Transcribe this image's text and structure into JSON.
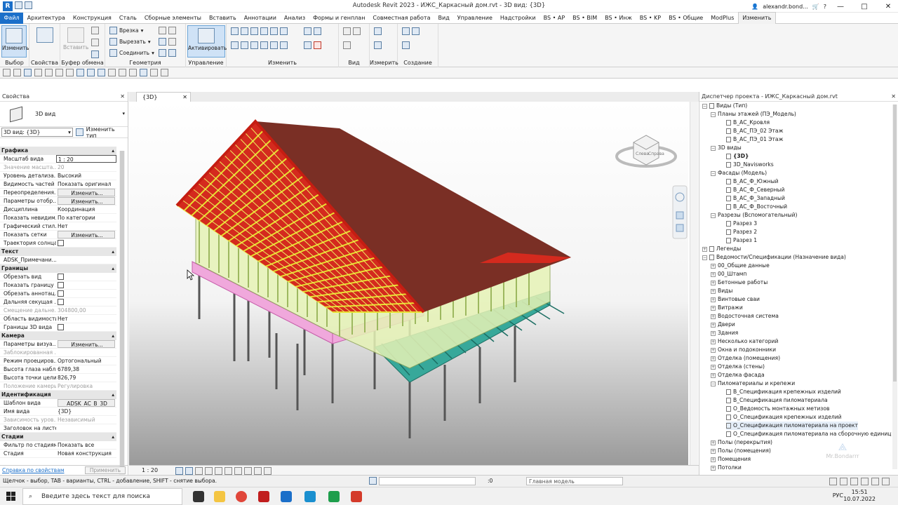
{
  "window": {
    "title": "Autodesk Revit 2023 - ИЖС_Каркасный дом.rvt - 3D вид: {3D}",
    "user": "alexandr.bond..."
  },
  "menu": [
    "Файл",
    "Архитектура",
    "Конструкция",
    "Сталь",
    "Сборные элементы",
    "Вставить",
    "Аннотации",
    "Анализ",
    "Формы и генплан",
    "Совместная работа",
    "Вид",
    "Управление",
    "Надстройки",
    "BS • AP",
    "BS • BIM",
    "BS • Инж",
    "BS • KP",
    "BS • Общие",
    "ModPlus",
    "Изменить"
  ],
  "ribbon": {
    "modify_btn": "Изменить",
    "paste_btn": "Вставить",
    "cut": "Врезка",
    "cutout": "Вырезать",
    "join": "Соединить",
    "activate_btn": "Активировать",
    "panels": {
      "select": "Выбор",
      "properties": "Свойства",
      "clipboard": "Буфер обмена",
      "geometry": "Геометрия",
      "control": "Управление",
      "modify": "Изменить",
      "view": "Вид",
      "measure": "Измерить",
      "create": "Создание"
    }
  },
  "properties": {
    "title": "Свойства",
    "type_name": "3D вид",
    "selector": "3D вид: {3D}",
    "edit_type": "Изменить тип",
    "sections": [
      {
        "name": "Графика",
        "rows": [
          {
            "k": "Масштаб вида",
            "v": "1 : 20",
            "t": "input"
          },
          {
            "k": "Значение масшта...",
            "v": "20",
            "t": "dim"
          },
          {
            "k": "Уровень детализа...",
            "v": "Высокий"
          },
          {
            "k": "Видимость частей",
            "v": "Показать оригинал"
          },
          {
            "k": "Переопределения...",
            "v": "Изменить...",
            "t": "btn"
          },
          {
            "k": "Параметры отобр...",
            "v": "Изменить...",
            "t": "btn"
          },
          {
            "k": "Дисциплина",
            "v": "Координация"
          },
          {
            "k": "Показать невидим...",
            "v": "По категории"
          },
          {
            "k": "Графический стил...",
            "v": "Нет"
          },
          {
            "k": "Показать сетки",
            "v": "Изменить...",
            "t": "btn"
          },
          {
            "k": "Траектория солнца",
            "v": "",
            "t": "cb"
          }
        ]
      },
      {
        "name": "Текст",
        "rows": [
          {
            "k": "ADSK_Примечани...",
            "v": ""
          }
        ]
      },
      {
        "name": "Границы",
        "rows": [
          {
            "k": "Обрезать вид",
            "v": "",
            "t": "cb"
          },
          {
            "k": "Показать границу ...",
            "v": "",
            "t": "cb"
          },
          {
            "k": "Обрезать аннотац...",
            "v": "",
            "t": "cb"
          },
          {
            "k": "Дальняя секущая ...",
            "v": "",
            "t": "cb"
          },
          {
            "k": "Смещение дальне...",
            "v": "304800,00",
            "t": "dim"
          },
          {
            "k": "Область видимости",
            "v": "Нет"
          },
          {
            "k": "Границы 3D вида",
            "v": "",
            "t": "cb"
          }
        ]
      },
      {
        "name": "Камера",
        "rows": [
          {
            "k": "Параметры визуа...",
            "v": "Изменить...",
            "t": "btn"
          },
          {
            "k": "Заблокированная ...",
            "v": "",
            "t": "dim"
          },
          {
            "k": "Режим проециров...",
            "v": "Ортогональный"
          },
          {
            "k": "Высота глаза набл...",
            "v": "6789,38"
          },
          {
            "k": "Высота точки цели",
            "v": "826,79"
          },
          {
            "k": "Положение камеры",
            "v": "Регулировка",
            "t": "dim"
          }
        ]
      },
      {
        "name": "Идентификация",
        "rows": [
          {
            "k": "Шаблон вида",
            "v": "ADSK_AC_B_3D",
            "t": "btn"
          },
          {
            "k": "Имя вида",
            "v": "{3D}"
          },
          {
            "k": "Зависимость уров...",
            "v": "Независимый",
            "t": "dim"
          },
          {
            "k": "Заголовок на листе",
            "v": ""
          }
        ]
      },
      {
        "name": "Стадии",
        "rows": [
          {
            "k": "Фильтр по стадиям",
            "v": "Показать все"
          },
          {
            "k": "Стадия",
            "v": "Новая конструкция"
          }
        ]
      }
    ],
    "help_link": "Справка по свойствам",
    "apply": "Применить"
  },
  "view": {
    "tab": "{3D}",
    "scale": "1 : 20"
  },
  "browser": {
    "title": "Диспетчер проекта - ИЖС_Каркасный дом.rvt",
    "items": [
      {
        "t": "Виды (Тип)",
        "l": 0,
        "tg": "−",
        "ico": "v"
      },
      {
        "t": "Планы этажей (ПЭ_Модель)",
        "l": 1,
        "tg": "−"
      },
      {
        "t": "В_АС_Кровля",
        "l": 2,
        "ico": "i"
      },
      {
        "t": "В_АС_ПЭ_02 Этаж",
        "l": 2,
        "ico": "i"
      },
      {
        "t": "В_АС_ПЭ_01 Этаж",
        "l": 2,
        "ico": "i"
      },
      {
        "t": "3D виды",
        "l": 1,
        "tg": "−"
      },
      {
        "t": "{3D}",
        "l": 2,
        "ico": "i",
        "b": true
      },
      {
        "t": "3D_Navisworks",
        "l": 2,
        "ico": "i"
      },
      {
        "t": "Фасады (Модель)",
        "l": 1,
        "tg": "−"
      },
      {
        "t": "В_АС_Ф_Южный",
        "l": 2,
        "ico": "i"
      },
      {
        "t": "В_АС_Ф_Северный",
        "l": 2,
        "ico": "i"
      },
      {
        "t": "В_АС_Ф_Западный",
        "l": 2,
        "ico": "i"
      },
      {
        "t": "В_АС_Ф_Восточный",
        "l": 2,
        "ico": "i"
      },
      {
        "t": "Разрезы (Вспомогательный)",
        "l": 1,
        "tg": "−"
      },
      {
        "t": "Разрез 3",
        "l": 2,
        "ico": "i"
      },
      {
        "t": "Разрез 2",
        "l": 2,
        "ico": "i"
      },
      {
        "t": "Разрез 1",
        "l": 2,
        "ico": "i"
      },
      {
        "t": "Легенды",
        "l": 0,
        "tg": "+",
        "ico": "i"
      },
      {
        "t": "Ведомости/Спецификации (Назначение вида)",
        "l": 0,
        "tg": "−",
        "ico": "i"
      },
      {
        "t": "00_Общие данные",
        "l": 1,
        "tg": "+"
      },
      {
        "t": "00_Штамп",
        "l": 1,
        "tg": "+"
      },
      {
        "t": "Бетонные работы",
        "l": 1,
        "tg": "+"
      },
      {
        "t": "Виды",
        "l": 1,
        "tg": "+"
      },
      {
        "t": "Винтовые сваи",
        "l": 1,
        "tg": "+"
      },
      {
        "t": "Витражи",
        "l": 1,
        "tg": "+"
      },
      {
        "t": "Водосточная система",
        "l": 1,
        "tg": "+"
      },
      {
        "t": "Двери",
        "l": 1,
        "tg": "+"
      },
      {
        "t": "Здания",
        "l": 1,
        "tg": "+"
      },
      {
        "t": "Несколько категорий",
        "l": 1,
        "tg": "+"
      },
      {
        "t": "Окна и подоконники",
        "l": 1,
        "tg": "+"
      },
      {
        "t": "Отделка (помещения)",
        "l": 1,
        "tg": "+"
      },
      {
        "t": "Отделка (стены)",
        "l": 1,
        "tg": "+"
      },
      {
        "t": "Отделка фасада",
        "l": 1,
        "tg": "+"
      },
      {
        "t": "Пиломатериалы и крепежи",
        "l": 1,
        "tg": "−"
      },
      {
        "t": "В_Спецификация крепежных изделий",
        "l": 2,
        "ico": "i"
      },
      {
        "t": "В_Спецификация пиломатериала",
        "l": 2,
        "ico": "i"
      },
      {
        "t": "О_Ведомость монтажных метизов",
        "l": 2,
        "ico": "i"
      },
      {
        "t": "О_Спецификация крепежных изделий",
        "l": 2,
        "ico": "i"
      },
      {
        "t": "О_Спецификация пиломатериала на проект",
        "l": 2,
        "ico": "i",
        "sel": true
      },
      {
        "t": "О_Спецификация пиломатериала на сборочную единицу",
        "l": 2,
        "ico": "i"
      },
      {
        "t": "Полы (перекрытия)",
        "l": 1,
        "tg": "+"
      },
      {
        "t": "Полы (помещения)",
        "l": 1,
        "tg": "+"
      },
      {
        "t": "Помещения",
        "l": 1,
        "tg": "+"
      },
      {
        "t": "Потолки",
        "l": 1,
        "tg": "+"
      }
    ]
  },
  "status": {
    "message": "Щелчок - выбор, TAB - варианты, CTRL - добавление, SHIFT - снятие выбора.",
    "zero": ":0",
    "model": "Главная модель"
  },
  "taskbar": {
    "search": "Введите здесь текст для поиска",
    "lang": "РУС",
    "time": "15:51",
    "date": "10.07.2022"
  },
  "watermark": "Mr.Bondarrr",
  "viewcube": {
    "left": "Слева",
    "front": "Справа"
  },
  "colors": {
    "accent": "#1b6fc9",
    "roof_frame": "#d42a1e",
    "rafters": "#e8e030",
    "shingles": "#7a2f25",
    "walls": "#dff0a8",
    "floor_teal": "#2a9c8c",
    "floor_pink": "#e889c8"
  }
}
